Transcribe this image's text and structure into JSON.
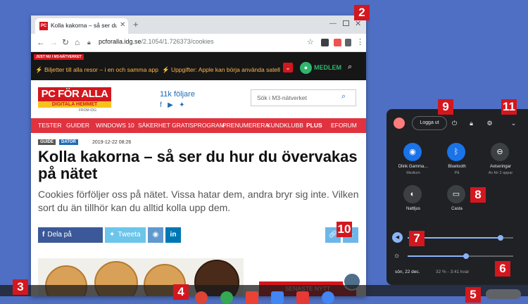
{
  "browser": {
    "tab_title": "Kolla kakorna – så ser du hur d",
    "tab_favicon": "PC",
    "url_domain": "pcforalla.idg.se",
    "url_path": "/2.1054/1.726373/cookies",
    "ticker_label": "JUST NU I M3-NÄTVERKET",
    "ticker_items": [
      "⚡ Biljetter till alla resor – i en och samma app",
      "⚡ Uppgifter: Apple kan börja använda satelliter"
    ],
    "member_label": "MEDLEM"
  },
  "site": {
    "logo_top": "PC FÖR ALLA",
    "logo_mid": "DIGITALA HEMMET",
    "logo_bot": "FROM IDG",
    "followers": "11k följare",
    "search_placeholder": "Sök i M3-nätverket",
    "menu": [
      "TESTER",
      "GUIDER",
      "WINDOWS 10",
      "SÄKERHET",
      "GRATISPROGRAM",
      "PRENUMERERA",
      "KUNDKLUBB",
      "PLUS",
      "EFORUM"
    ]
  },
  "article": {
    "badges": [
      "GUIDE",
      "DATOR"
    ],
    "date": "2019-12-22 08:26",
    "headline": "Kolla kakorna – så ser du hur du övervakas på nätet",
    "lead": "Cookies förföljer oss på nätet. Vissa hatar dem, andra bryr sig inte. Vilken sort du än tillhör kan du alltid kolla upp dem.",
    "share_facebook": "Dela på Facebook",
    "share_twitter": "Tweeta",
    "latest": "SENASTE NYTT"
  },
  "quick_settings": {
    "logout": "Logga ut",
    "tiles": [
      {
        "label": "Dlink Gamma…",
        "sub": "Medium",
        "icon": "wifi-icon"
      },
      {
        "label": "Bluetooth",
        "sub": "På",
        "icon": "bluetooth-icon"
      },
      {
        "label": "Aviseringar",
        "sub": "Av för 2 appar",
        "icon": "notifications-icon"
      },
      {
        "label": "Nattljus",
        "sub": "",
        "icon": "night-light-icon"
      },
      {
        "label": "Casta",
        "sub": "",
        "icon": "cast-icon"
      }
    ],
    "volume_level": 0.88,
    "brightness_level": 0.55,
    "date": "sön, 22 dec.",
    "battery": "32 % - 3:41 kvar"
  },
  "callouts": [
    "2",
    "3",
    "4",
    "5",
    "6",
    "7",
    "8",
    "9",
    "10",
    "11"
  ],
  "colors": {
    "desktop": "#4f6fc4",
    "accent": "#d3171e",
    "qs_active": "#8ab4f8"
  }
}
